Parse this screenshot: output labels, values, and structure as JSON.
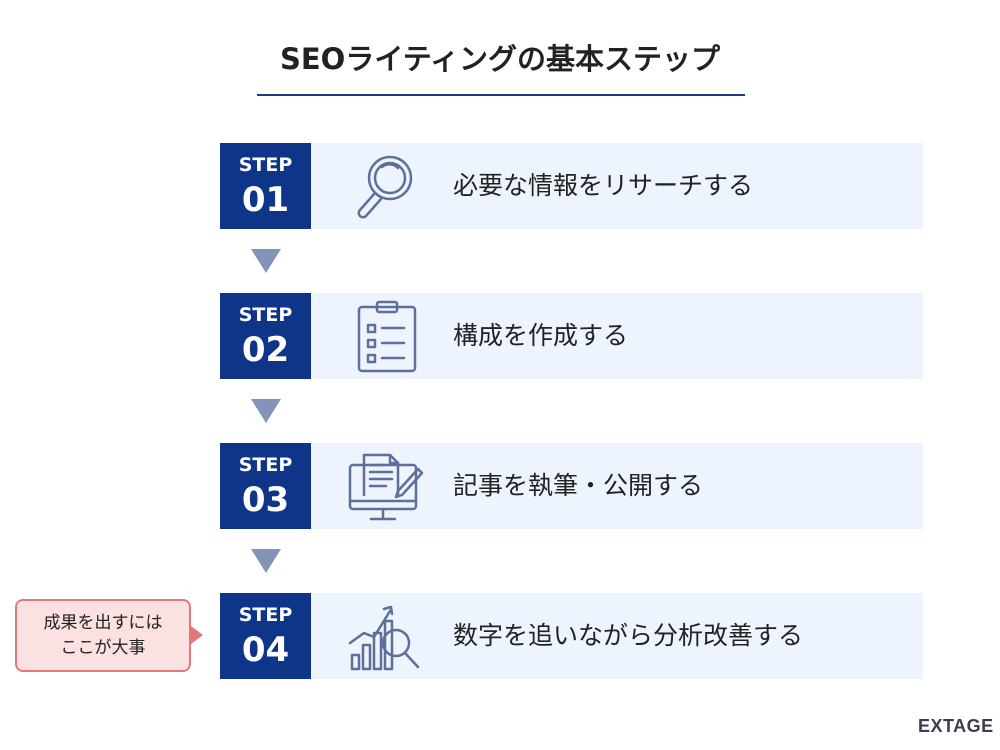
{
  "title": "SEOライティングの基本ステップ",
  "steps": [
    {
      "label": "STEP",
      "number": "01",
      "text": "必要な情報をリサーチする",
      "icon": "magnifier-icon"
    },
    {
      "label": "STEP",
      "number": "02",
      "text": "構成を作成する",
      "icon": "clipboard-checklist-icon"
    },
    {
      "label": "STEP",
      "number": "03",
      "text": "記事を執筆・公開する",
      "icon": "monitor-document-pen-icon"
    },
    {
      "label": "STEP",
      "number": "04",
      "text": "数字を追いながら分析改善する",
      "icon": "chart-magnifier-icon"
    }
  ],
  "callout": {
    "line1": "成果を出すには",
    "line2": "ここが大事"
  },
  "logo": "EXTAGE",
  "colors": {
    "step_box": "#0e3587",
    "panel": "#eef4fd",
    "arrow": "#8494b8",
    "icon_stroke": "#5d6f9b",
    "callout_bg": "#fbe1e1",
    "callout_border": "#e5777b",
    "title_rule": "#1e3a84"
  }
}
